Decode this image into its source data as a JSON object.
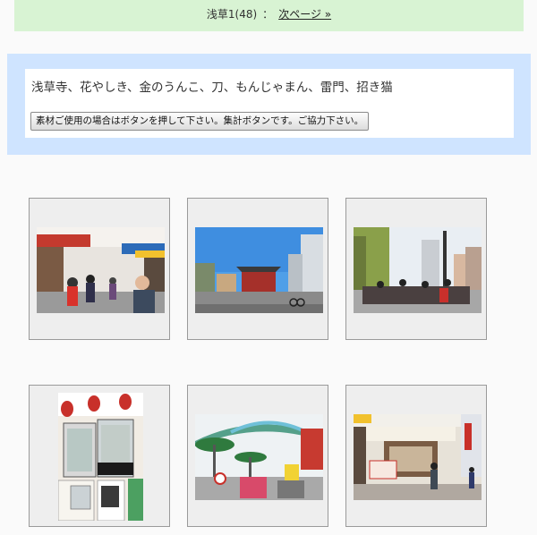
{
  "nav": {
    "current": "浅草1(48)",
    "separator": "：",
    "next_label": "次ページ »"
  },
  "info": {
    "keywords": "浅草寺、花やしき、金のうんこ、刀、もんじゃまん、雷門、招き猫",
    "vote_button_label": "素材ご使用の場合はボタンを押して下さい。集計ボタンです。ご協力下さい。"
  },
  "photos": [
    {
      "icon": "shopping-street-photo"
    },
    {
      "icon": "temple-gate-photo"
    },
    {
      "icon": "crowd-plaza-photo"
    },
    {
      "icon": "shop-display-photo"
    },
    {
      "icon": "amusement-park-photo"
    },
    {
      "icon": "storefront-photo"
    }
  ],
  "colors": {
    "nav_bg": "#d8f3d3",
    "info_bg": "#cfe4ff",
    "thumb_bg": "#eeeeee"
  }
}
